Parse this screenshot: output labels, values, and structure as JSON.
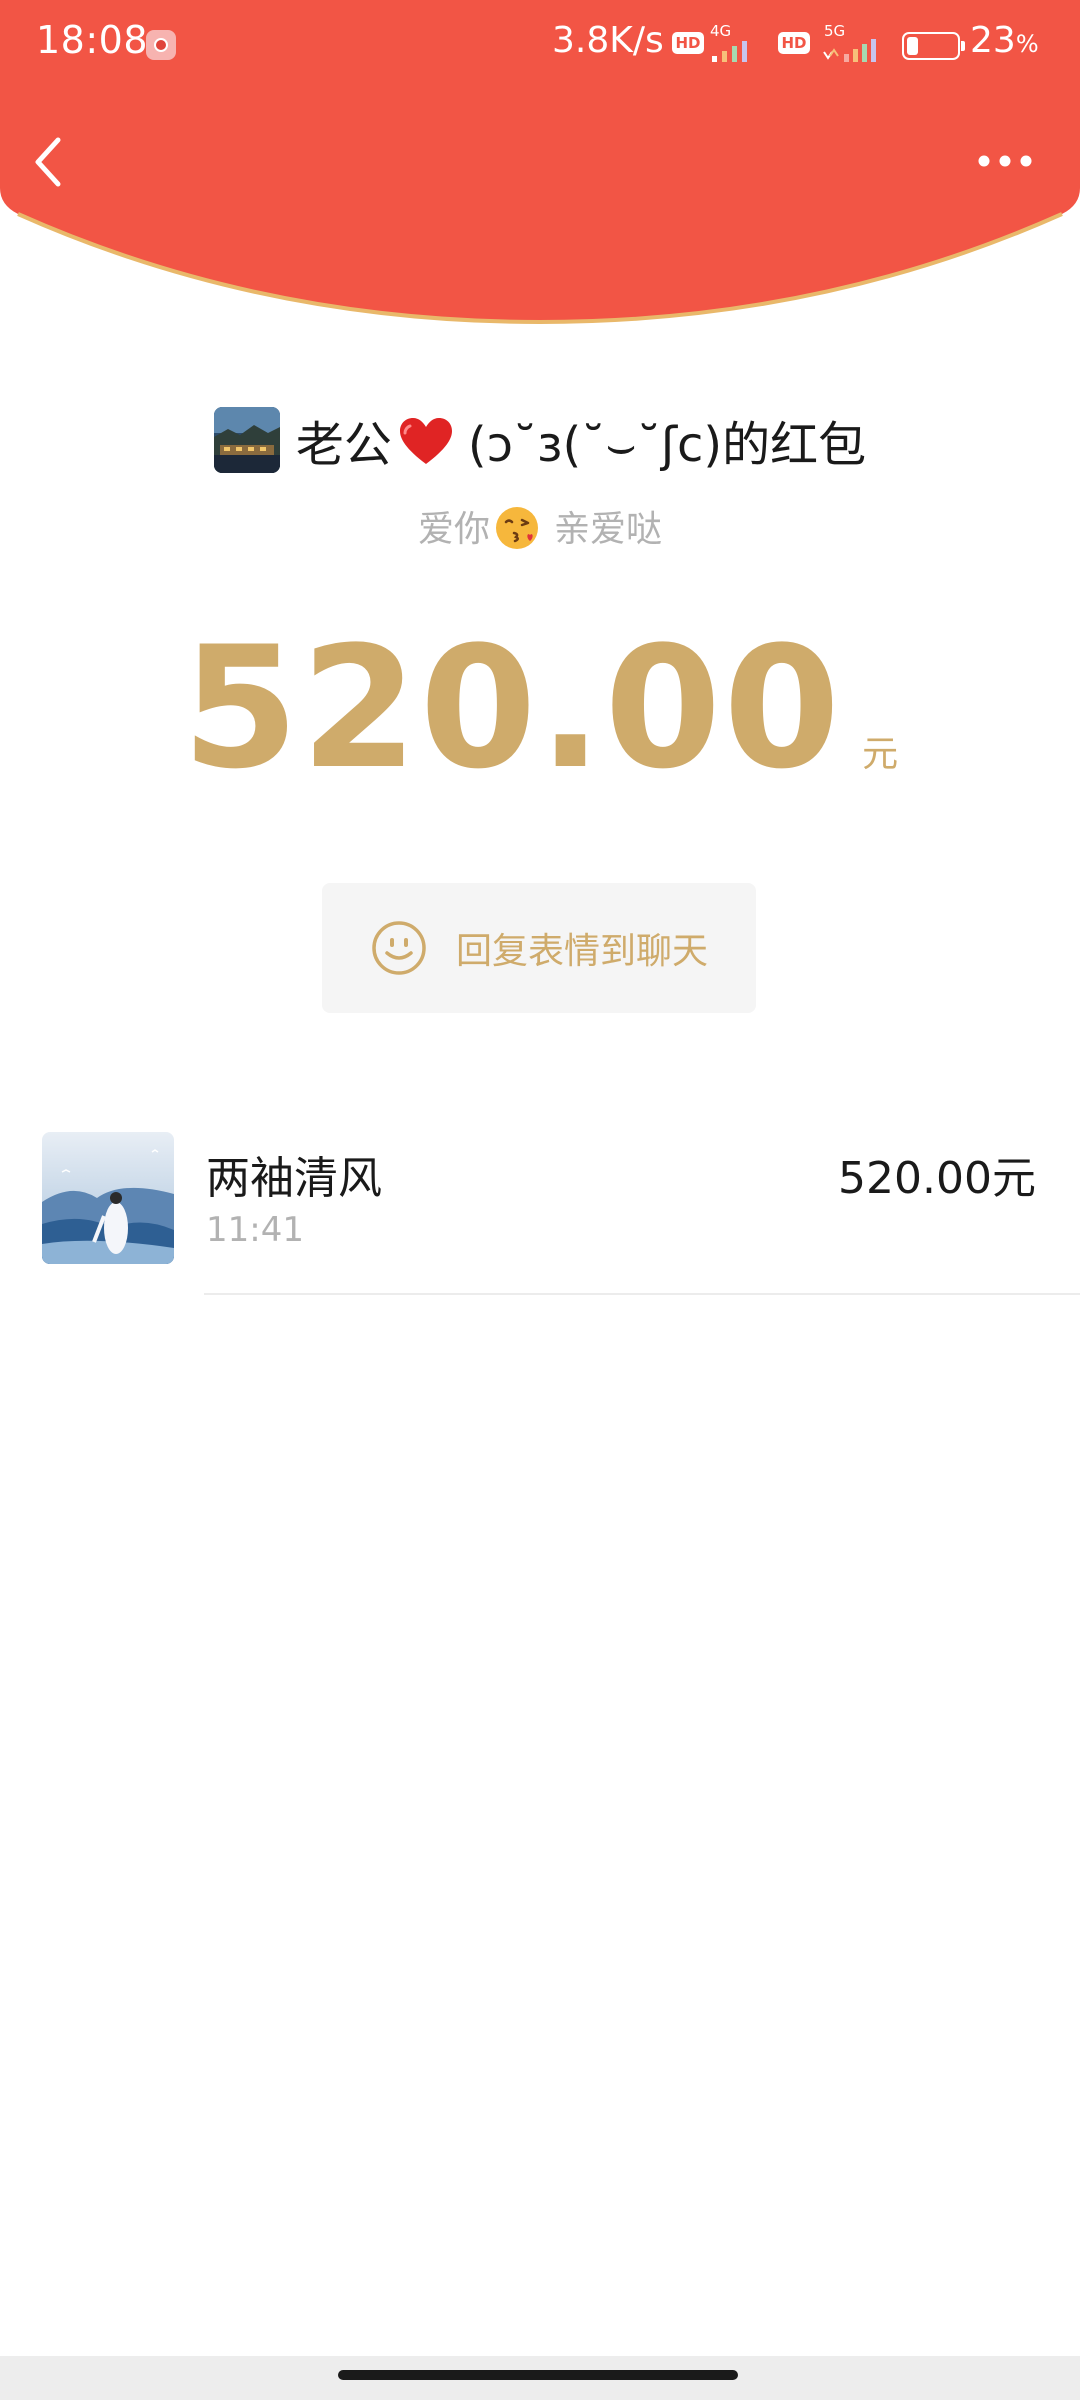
{
  "status_bar": {
    "time": "18:08",
    "net_speed": "3.8K/s",
    "hd_badge": "HD",
    "sim1_label": "4G",
    "sim2_label": "5G",
    "battery_percent": 23,
    "battery_text": "23",
    "battery_unit": "%"
  },
  "header": {
    "accent_color": "#f25545",
    "rim_color": "#e9b86a"
  },
  "packet": {
    "title_prefix": "老公",
    "title_suffix": "(ɔ˘з(˘⌣˘ʃc)的红包",
    "blessing_prefix": "爱你",
    "blessing_suffix": "亲爱哒",
    "amount": "520.00",
    "unit": "元",
    "amount_color": "#cfab6b"
  },
  "reply": {
    "label": "回复表情到聊天"
  },
  "receivers": [
    {
      "name": "两袖清风",
      "time": "11:41",
      "amount": "520.00元"
    }
  ]
}
